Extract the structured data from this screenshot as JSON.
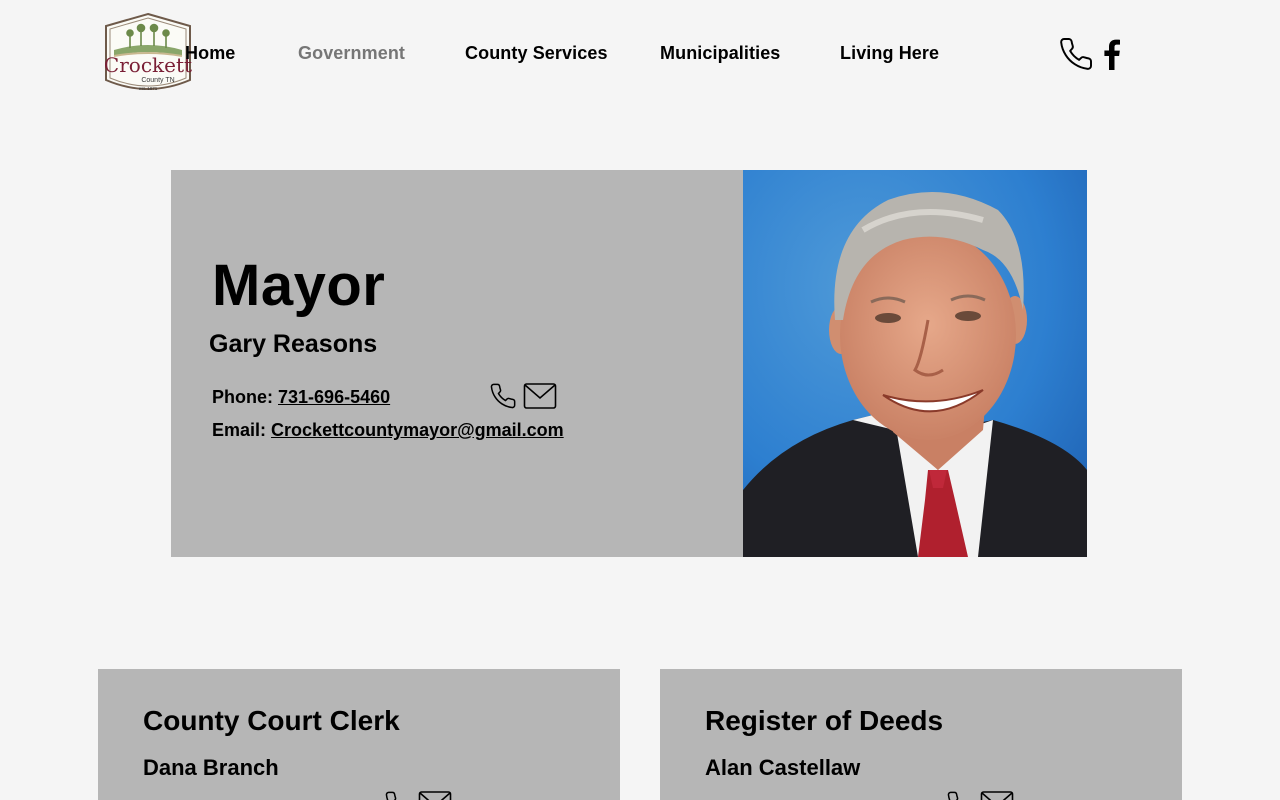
{
  "header": {
    "logo": {
      "name": "Crockett",
      "subtitle": "County TN",
      "est": "est. 1871",
      "icon": "crockett-county-logo"
    },
    "nav": [
      {
        "label": "Home",
        "active": false
      },
      {
        "label": "Government",
        "active": true
      },
      {
        "label": "County Services",
        "active": false
      },
      {
        "label": "Municipalities",
        "active": false
      },
      {
        "label": "Living Here",
        "active": false
      }
    ],
    "icons": [
      "phone-icon",
      "facebook-icon"
    ]
  },
  "mayor": {
    "title": "Mayor",
    "name": "Gary Reasons",
    "phone_label": "Phone:",
    "phone": "731-696-5460",
    "email_label": "Email:",
    "email": "Crockettcountymayor@gmail.com",
    "icons": [
      "phone-icon",
      "mail-icon"
    ],
    "photo": "portrait-photo"
  },
  "offices": [
    {
      "title": "County Court Clerk",
      "name": "Dana Branch"
    },
    {
      "title": "Register of Deeds",
      "name": "Alan Castellaw"
    }
  ],
  "colors": {
    "background": "#f5f5f5",
    "card": "#b6b6b6",
    "nav_active": "#767676",
    "logo_maroon": "#7a1f35",
    "logo_green": "#6c8a4a"
  }
}
